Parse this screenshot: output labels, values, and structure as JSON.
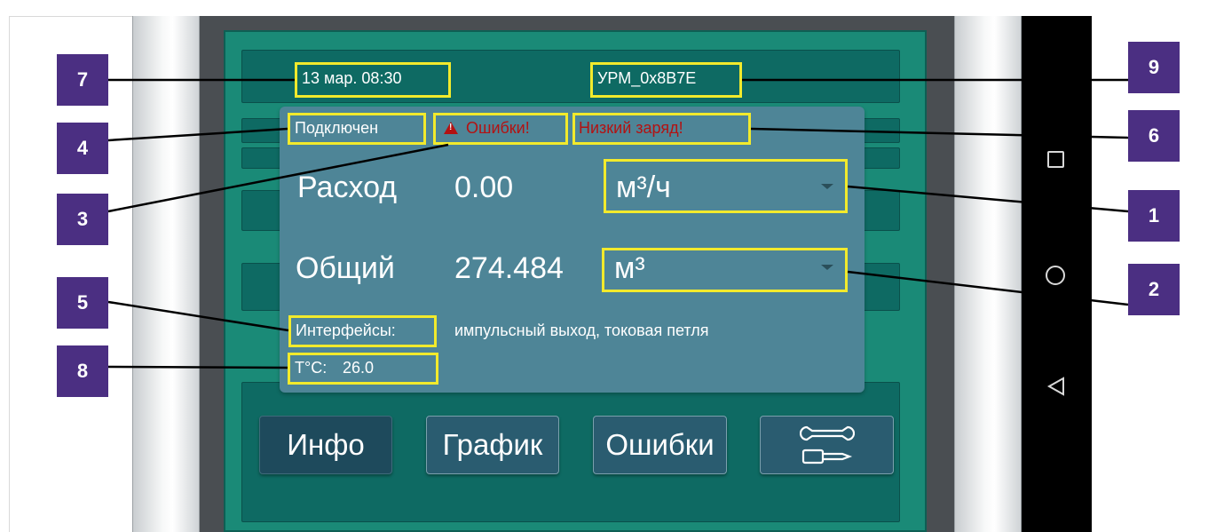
{
  "status_bar": {
    "datetime": "13 мар. 08:30",
    "device_id": "УРМ_0x8B7E"
  },
  "indicators": {
    "connection": "Подключен",
    "errors": "Ошибки!",
    "battery": "Низкий заряд!"
  },
  "readings": {
    "flow_label": "Расход",
    "flow_value": "0.00",
    "flow_unit": "м³/ч",
    "total_label": "Общий",
    "total_value": "274.484",
    "total_unit": "м³"
  },
  "interfaces": {
    "label": "Интерфейсы:",
    "value": "импульсный выход, токовая петля"
  },
  "temperature": {
    "label": "T°C:",
    "value": "26.0"
  },
  "buttons": {
    "info": "Инфо",
    "chart": "График",
    "errors": "Ошибки",
    "settings_icon": "tools-icon"
  },
  "callouts": [
    "7",
    "9",
    "4",
    "6",
    "3",
    "1",
    "5",
    "2",
    "8"
  ],
  "android_nav": {
    "recents_icon": "square-icon",
    "home_icon": "circle-icon",
    "back_icon": "triangle-back-icon"
  },
  "colors": {
    "screen_bg": "#1a8a77",
    "card_bg": "#4e8597",
    "highlight": "#f2ea2c",
    "warning_text": "#b31212",
    "callout_bg": "#4b2f82",
    "button_bg": "#2a5c70"
  }
}
